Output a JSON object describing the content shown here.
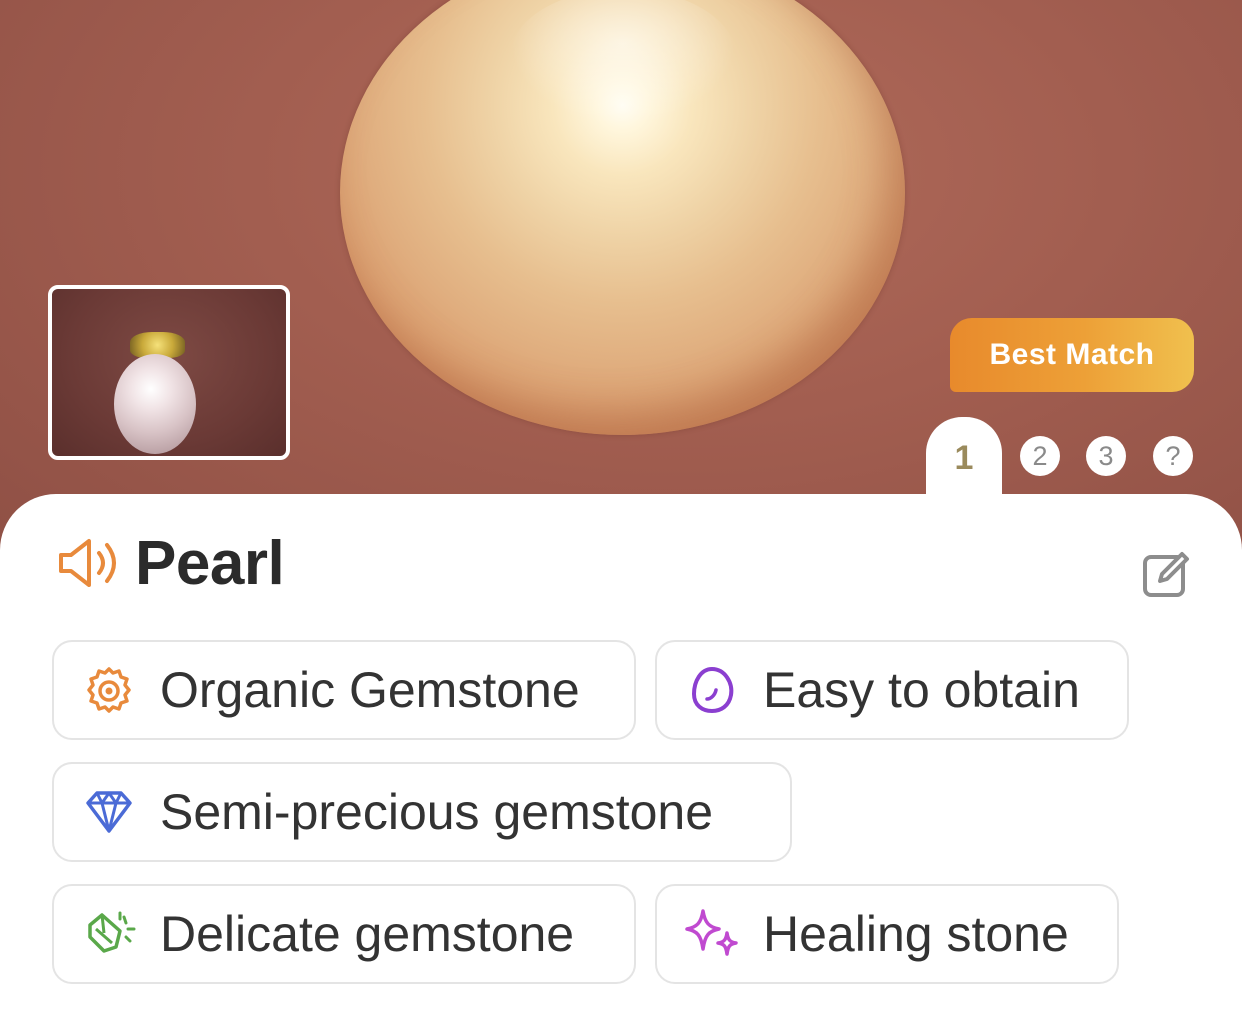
{
  "result": {
    "name": "Pearl",
    "badge": "Best Match",
    "pages": {
      "active": "1",
      "others": [
        "2",
        "3",
        "?"
      ]
    }
  },
  "tags": [
    {
      "label": "Organic Gemstone",
      "icon": "shell-icon",
      "color": "#e88a3c"
    },
    {
      "label": "Easy to obtain",
      "icon": "egg-icon",
      "color": "#8b3fd0"
    },
    {
      "label": "Semi-precious gemstone",
      "icon": "diamond-icon",
      "color": "#4b6bd6"
    },
    {
      "label": "Delicate gemstone",
      "icon": "crystal-icon",
      "color": "#5aa84a"
    },
    {
      "label": "Healing stone",
      "icon": "sparkles-icon",
      "color": "#c04ad0"
    }
  ],
  "colors": {
    "accent": "#e88a3c",
    "badge_gradient": [
      "#e88a2c",
      "#f0c04e"
    ],
    "background": "#a25e50"
  }
}
